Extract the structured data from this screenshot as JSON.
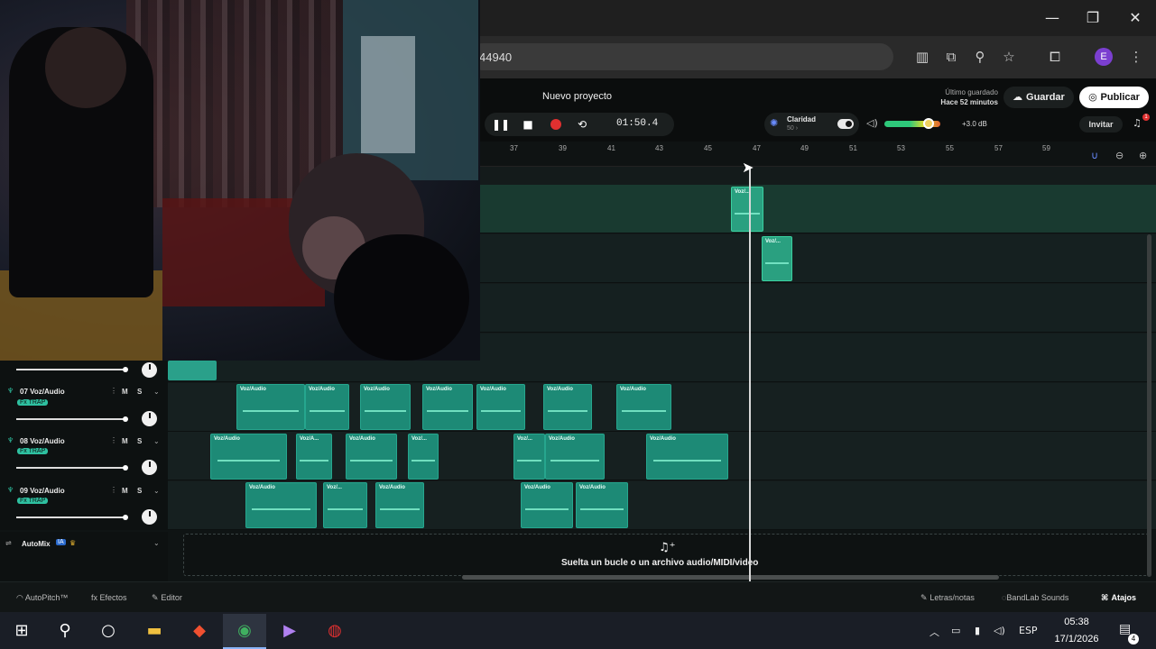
{
  "browser": {
    "url_fragment": "44940",
    "window_controls": {
      "minimize": "—",
      "maximize": "❐",
      "close": "✕"
    },
    "toolbar_icons": [
      "piano-icon",
      "cast-icon",
      "zoom-icon",
      "star-icon",
      "extensions-icon",
      "profile-avatar",
      "menu-icon"
    ],
    "profile_initial": "E"
  },
  "header": {
    "project_name": "Nuevo proyecto",
    "time": "01:50.4",
    "clarity": {
      "label": "Claridad",
      "value": "50 ›"
    },
    "gain": "+3.0 dB",
    "last_saved_label": "Último guardado",
    "last_saved_ago": "Hace 52 minutos",
    "save_label": "Guardar",
    "publish_label": "Publicar",
    "invite_label": "Invitar",
    "notif_count": "1"
  },
  "ruler": {
    "ticks": [
      "37",
      "39",
      "41",
      "43",
      "45",
      "47",
      "49",
      "51",
      "53",
      "55",
      "57",
      "59"
    ]
  },
  "tracks": [
    {
      "number": "07",
      "name": "Voz/Audio",
      "fx": "Fx TRAP",
      "mute": "M",
      "solo": "S"
    },
    {
      "number": "08",
      "name": "Voz/Audio",
      "fx": "Fx TRAP",
      "mute": "M",
      "solo": "S"
    },
    {
      "number": "09",
      "name": "Voz/Audio",
      "fx": "Fx TRAP",
      "mute": "M",
      "solo": "S"
    }
  ],
  "clips": {
    "upper_1": "Voz/...",
    "upper_2": "Voz/...",
    "t07": [
      "Voz/Audio",
      "Voz/Audio",
      "Voz/Audio",
      "Voz/Audio",
      "Voz/Audio",
      "Voz/Audio",
      "Voz/Audio"
    ],
    "t08": [
      "Voz/Audio",
      "Voz/A...",
      "Voz/Audio",
      "Voz/...",
      "Voz/...",
      "Voz/Audio",
      "Voz/Audio"
    ],
    "t09": [
      "Voz/Audio",
      "Voz/...",
      "Voz/Audio",
      "Voz/Audio",
      "Voz/Audio"
    ]
  },
  "automix": {
    "label": "AutoMix",
    "badge": "IA"
  },
  "drop_zone": {
    "text": "Suelta un bucle o un archivo audio/MIDI/video"
  },
  "footer": {
    "autopitch": "AutoPitch™",
    "effects": "Efectos",
    "editor": "Editor",
    "lyrics": "Letras/notas",
    "sounds": "BandLab Sounds",
    "shortcuts": "Atajos"
  },
  "taskbar": {
    "language": "ESP",
    "time": "05:38",
    "date": "17/1/2026",
    "notifications": "4"
  }
}
